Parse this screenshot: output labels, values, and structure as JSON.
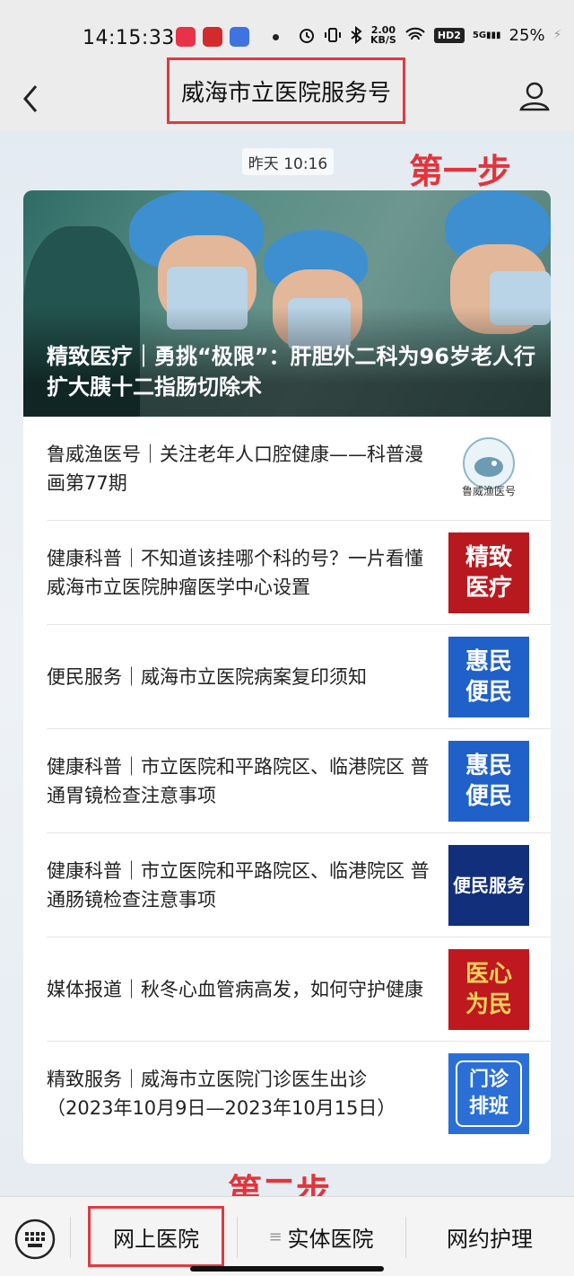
{
  "status_bar": {
    "time": "14:15:33",
    "network_speed_value": "2.00",
    "network_speed_unit": "KB/S",
    "hd_label": "HD2",
    "signal_label": "5G",
    "battery": "25%"
  },
  "header": {
    "title": "威海市立医院服务号"
  },
  "annotations": {
    "step1": "第一步",
    "step2": "第二步"
  },
  "message": {
    "timestamp": "昨天 10:16",
    "hero_title": "精致医疗｜勇挑“极限”：肝胆外二科为96岁老人行扩大胰十二指肠切除术",
    "items": [
      {
        "title": "鲁威渔医号｜关注老年人口腔健康——科普漫画第77期",
        "thumb_text": "鲁威渔医号"
      },
      {
        "title": "健康科普｜不知道该挂哪个科的号？一片看懂威海市立医院肿瘤医学中心设置",
        "thumb_text": "精致医疗"
      },
      {
        "title": "便民服务｜威海市立医院病案复印须知",
        "thumb_text": "惠民便民"
      },
      {
        "title": "健康科普｜市立医院和平路院区、临港院区 普通胃镜检查注意事项",
        "thumb_text": "惠民便民"
      },
      {
        "title": "健康科普｜市立医院和平路院区、临港院区 普通肠镜检查注意事项",
        "thumb_text": "便民服务"
      },
      {
        "title": "媒体报道｜秋冬心血管病高发，如何守护健康",
        "thumb_text": "医心为民"
      },
      {
        "title": "精致服务｜威海市立医院门诊医生出诊（2023年10月9日—2023年10月15日）",
        "thumb_text": "门诊排班"
      }
    ]
  },
  "bottom_menu": {
    "online_hospital": "网上医院",
    "physical_hospital": "实体医院",
    "nursing": "网约护理",
    "list_icon": "≡"
  },
  "colors": {
    "annotation_red": "#e2343a",
    "highlight_border": "#e0393f"
  }
}
